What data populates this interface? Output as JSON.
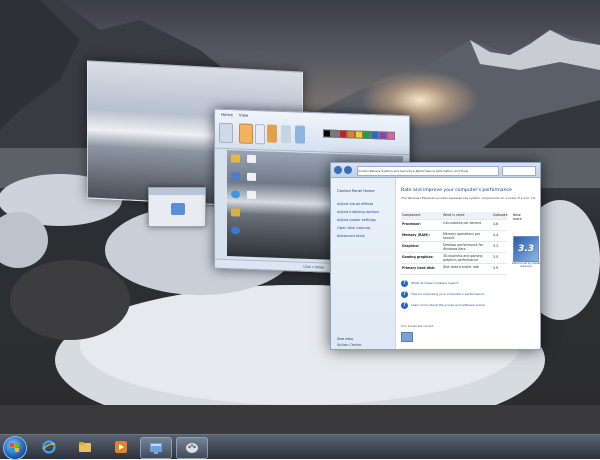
{
  "paint": {
    "tabs": [
      "Home",
      "View"
    ],
    "status": "1200 × 900px"
  },
  "performance": {
    "address": "Control Panel ▸ System and Security ▸ Performance Information and Tools",
    "sidebar_heading": "Control Panel Home",
    "sidebar_links": [
      "Adjust visual effects",
      "Adjust indexing options",
      "Adjust power settings",
      "Open disk cleanup",
      "Advanced tools"
    ],
    "sidebar_bottom_heading": "See also",
    "sidebar_bottom_link": "Action Center",
    "heading": "Rate and improve your computer's performance",
    "subtitle": "The Windows Experience Index assesses key system components on a scale of 1.0 to 7.9.",
    "table_headers": [
      "Component",
      "What is rated",
      "Subscore",
      "Base score"
    ],
    "rows": [
      {
        "component": "Processor:",
        "rated": "Calculations per second",
        "score": "4.6"
      },
      {
        "component": "Memory (RAM):",
        "rated": "Memory operations per second",
        "score": "4.4"
      },
      {
        "component": "Graphics:",
        "rated": "Desktop performance for Windows Aero",
        "score": "3.3"
      },
      {
        "component": "Gaming graphics:",
        "rated": "3D business and gaming graphics performance",
        "score": "3.5"
      },
      {
        "component": "Primary hard disk:",
        "rated": "Disk data transfer rate",
        "score": "5.9"
      }
    ],
    "base_score": "3.3",
    "base_score_caption": "Determined by lowest subscore",
    "help_links": [
      "What do these numbers mean?",
      "Tips for improving your computer's performance.",
      "Learn more about the scores and software online"
    ],
    "pc_info": "Your scores are current"
  },
  "colors": {
    "accent": "#2563c7",
    "link": "#1e4a8a"
  },
  "taskbar": {
    "items": [
      {
        "name": "start-button",
        "icon": "windows-logo-icon"
      },
      {
        "name": "internet-explorer",
        "icon": "ie-icon"
      },
      {
        "name": "windows-explorer",
        "icon": "folder-icon"
      },
      {
        "name": "media-player",
        "icon": "media-player-icon"
      },
      {
        "name": "control-panel",
        "icon": "control-panel-icon"
      },
      {
        "name": "paint",
        "icon": "paint-icon"
      }
    ]
  }
}
